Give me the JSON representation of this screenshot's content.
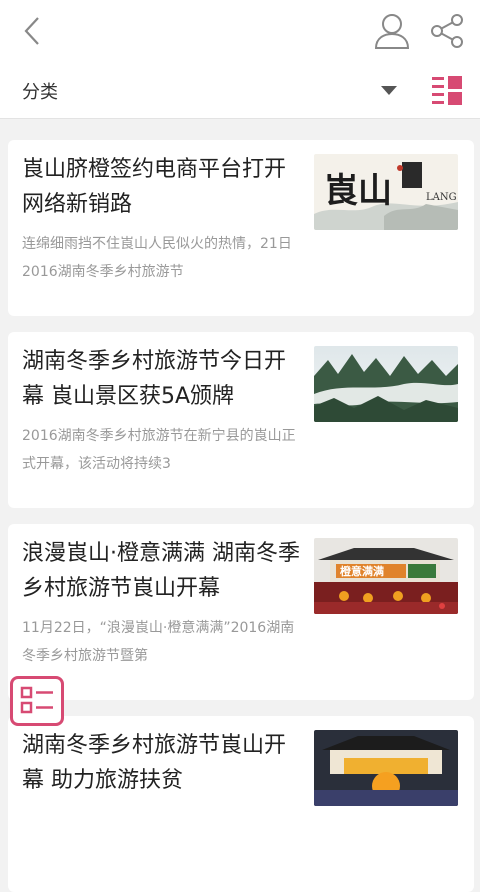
{
  "filter": {
    "label": "分类"
  },
  "articles": [
    {
      "title": "崀山脐橙签约电商平台打开网络新销路",
      "summary": "连绵细雨挡不住崀山人民似火的热情，21日2016湖南冬季乡村旅游节",
      "thumb_text": {
        "main": "崀山",
        "sub": "LANG"
      }
    },
    {
      "title": "湖南冬季乡村旅游节今日开幕 崀山景区获5A颁牌",
      "summary": "2016湖南冬季乡村旅游节在新宁县的崀山正式开幕，该活动将持续3"
    },
    {
      "title": "浪漫崀山·橙意满满 湖南冬季乡村旅游节崀山开幕",
      "summary": "11月22日，“浪漫崀山·橙意满满”2016湖南冬季乡村旅游节暨第",
      "thumb_text": {
        "banner": "橙意满满"
      }
    },
    {
      "title": "湖南冬季乡村旅游节崀山开幕 助力旅游扶贫",
      "summary": ""
    }
  ]
}
